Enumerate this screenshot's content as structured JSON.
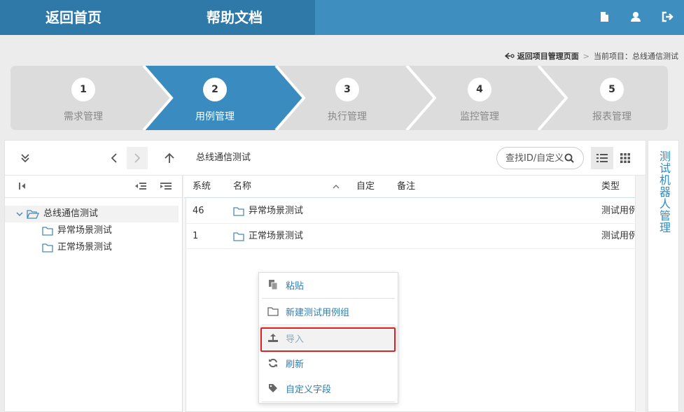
{
  "topbar": {
    "home_label": "返回首页",
    "help_label": "帮助文档",
    "icons": [
      "document-icon",
      "user-icon",
      "logout-icon"
    ],
    "colors": {
      "bar": "#3e8ebf",
      "bar_dark": "#2f79a8"
    }
  },
  "breadcrumb": {
    "back_label": "返回项目管理页面",
    "separator": ">",
    "current_label": "当前项目：总线通信测试"
  },
  "steps": [
    {
      "num": "1",
      "label": "需求管理",
      "active": false
    },
    {
      "num": "2",
      "label": "用例管理",
      "active": true
    },
    {
      "num": "3",
      "label": "执行管理",
      "active": false
    },
    {
      "num": "4",
      "label": "监控管理",
      "active": false
    },
    {
      "num": "5",
      "label": "报表管理",
      "active": false
    }
  ],
  "toolbar": {
    "path": "总线通信测试",
    "search_placeholder": "查找ID/自定义字段"
  },
  "tree": {
    "root": "总线通信测试",
    "children": [
      "异常场景测试",
      "正常场景测试"
    ]
  },
  "table": {
    "headers": {
      "system": "系统",
      "name": "名称",
      "custom": "自定",
      "remark": "备注",
      "type": "类型"
    },
    "rows": [
      {
        "system": "46",
        "name": "异常场景测试",
        "type": "测试用例组"
      },
      {
        "system": "1",
        "name": "正常场景测试",
        "type": "测试用例组"
      }
    ]
  },
  "side_tab": {
    "label": "测试机器人管理"
  },
  "context_menu": {
    "items": [
      {
        "label": "粘贴",
        "icon": "paste-icon"
      },
      {
        "label": "新建测试用例组",
        "icon": "folder-icon"
      },
      {
        "label": "导入",
        "icon": "upload-icon",
        "highlighted": true
      },
      {
        "label": "刷新",
        "icon": "refresh-icon"
      },
      {
        "label": "自定义字段",
        "icon": "tag-icon"
      }
    ]
  }
}
